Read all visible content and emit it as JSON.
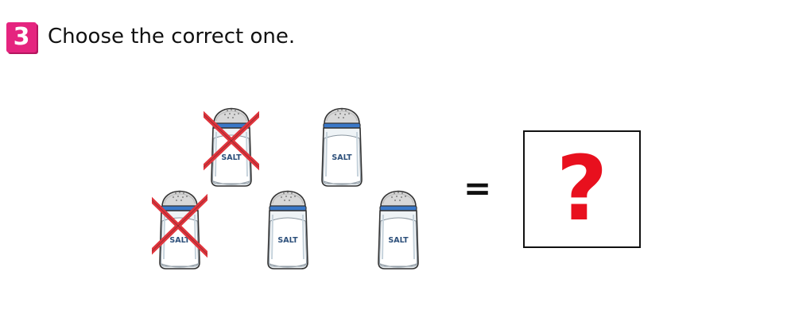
{
  "question": {
    "number": "3",
    "text": "Choose the correct one."
  },
  "shaker_label": "SALT",
  "shakers": [
    {
      "crossed": true
    },
    {
      "crossed": false
    },
    {
      "crossed": true
    },
    {
      "crossed": false
    },
    {
      "crossed": false
    }
  ],
  "operator": "=",
  "answer": {
    "symbol": "?",
    "color": "#e8101e"
  },
  "colors": {
    "badge": "#e5247f",
    "cross": "#e0343c",
    "band": "#3a78c8"
  }
}
